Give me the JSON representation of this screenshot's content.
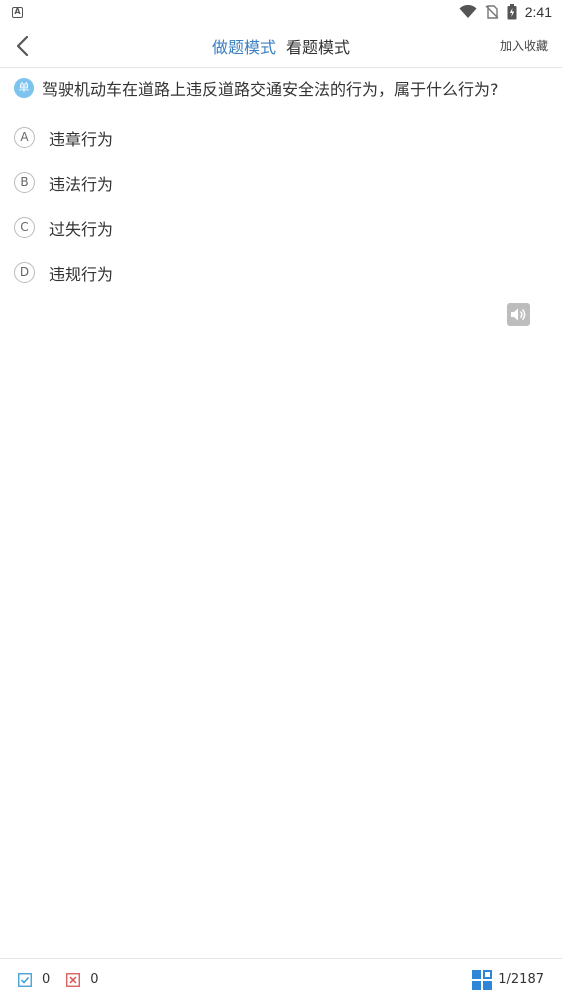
{
  "status_bar": {
    "time": "2:41",
    "notification_icon_letter": "A"
  },
  "header": {
    "tabs": [
      {
        "label": "做题模式",
        "active": true
      },
      {
        "label": "看题模式",
        "active": false
      }
    ],
    "favorite_label": "加入收藏"
  },
  "question": {
    "type_badge": "单",
    "text": "驾驶机动车在道路上违反道路交通安全法的行为，属于什么行为?",
    "options": [
      {
        "letter": "A",
        "text": "违章行为"
      },
      {
        "letter": "B",
        "text": "违法行为"
      },
      {
        "letter": "C",
        "text": "过失行为"
      },
      {
        "letter": "D",
        "text": "违规行为"
      }
    ]
  },
  "bottom_bar": {
    "correct_count": "0",
    "wrong_count": "0",
    "progress": "1/2187"
  },
  "colors": {
    "accent": "#3a7fc1",
    "badge": "#7cc4ee",
    "correct": "#3a9bd6",
    "wrong": "#d9534f",
    "grid": "#2f86d6"
  },
  "icons": [
    "back-arrow-icon",
    "wifi-icon",
    "no-sim-icon",
    "battery-charging-icon",
    "speaker-icon",
    "check-box-icon",
    "cross-box-icon",
    "grid-icon"
  ]
}
